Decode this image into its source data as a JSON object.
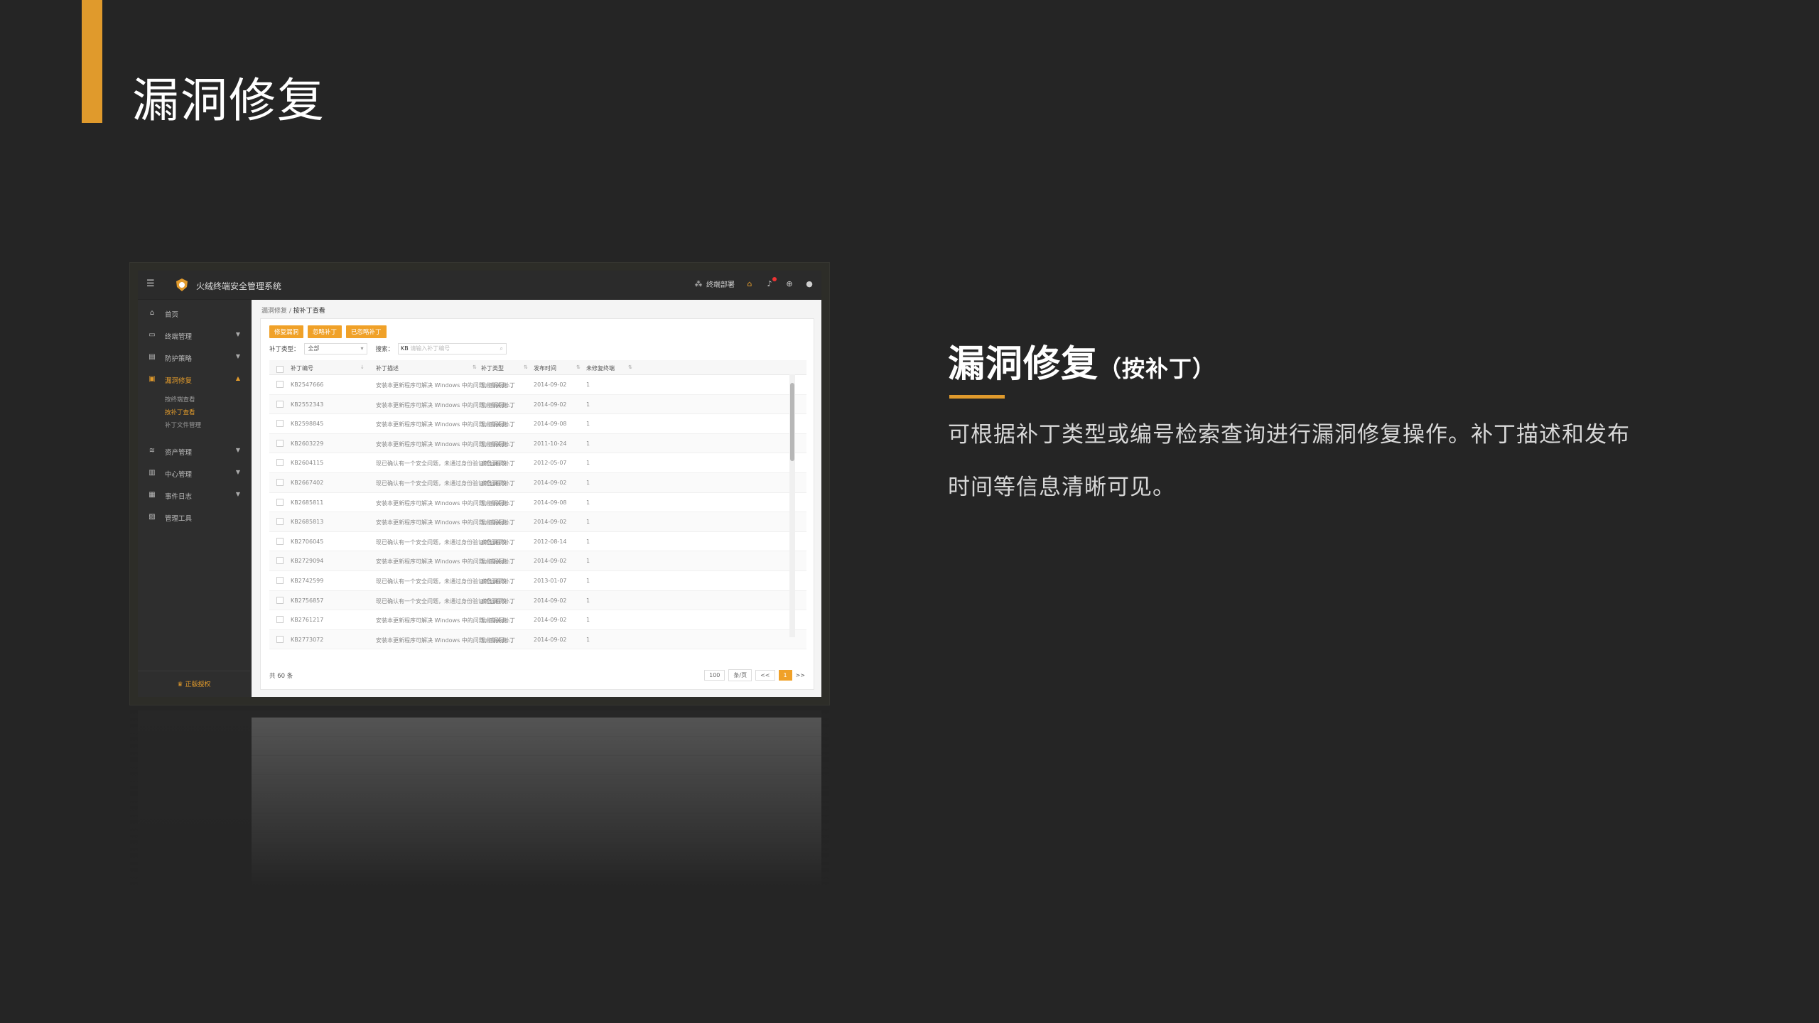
{
  "slide": {
    "title": "漏洞修复",
    "heading": "漏洞修复",
    "heading_sub": "（按补丁）",
    "description": "可根据补丁类型或编号检索查询进行漏洞修复操作。补丁描述和发布时间等信息清晰可见。",
    "accent_color": "#e09a2c"
  },
  "app": {
    "title": "火绒终端安全管理系统",
    "topbar": {
      "deploy_label": "终端部署",
      "icons": [
        "home-icon",
        "bell-icon",
        "globe-icon",
        "user-icon"
      ]
    },
    "sidebar": {
      "items": [
        {
          "label": "首页",
          "icon": "home-icon"
        },
        {
          "label": "终端管理",
          "icon": "monitor-icon"
        },
        {
          "label": "防护策略",
          "icon": "shield-icon"
        },
        {
          "label": "漏洞修复",
          "icon": "patch-icon",
          "active": true
        },
        {
          "label": "资产管理",
          "icon": "layers-icon"
        },
        {
          "label": "中心管理",
          "icon": "book-icon"
        },
        {
          "label": "事件日志",
          "icon": "log-icon"
        },
        {
          "label": "管理工具",
          "icon": "toolbox-icon"
        }
      ],
      "sub_items": [
        {
          "label": "按终端查看"
        },
        {
          "label": "按补丁查看",
          "active": true
        },
        {
          "label": "补丁文件管理"
        }
      ],
      "license": "正版授权"
    },
    "breadcrumb": {
      "parent": "漏洞修复",
      "current": "按补丁查看"
    },
    "buttons": [
      "修复漏洞",
      "忽略补丁",
      "已忽略补丁"
    ],
    "filter": {
      "type_label": "补丁类型：",
      "type_value": "全部",
      "search_label": "搜索：",
      "search_prefix": "KB",
      "search_placeholder": "请输入补丁编号"
    },
    "table": {
      "headers": [
        "补丁编号",
        "补丁描述",
        "补丁类型",
        "发布时间",
        "未修复终端"
      ],
      "rows": [
        {
          "id": "KB2547666",
          "desc": "安装本更新程序可解决 Windows 中的问题。有关此...",
          "type": "功能漏洞补丁",
          "date": "2014-09-02",
          "count": "1"
        },
        {
          "id": "KB2552343",
          "desc": "安装本更新程序可解决 Windows 中的问题。有关此...",
          "type": "功能漏洞补丁",
          "date": "2014-09-02",
          "count": "1"
        },
        {
          "id": "KB2598845",
          "desc": "安装本更新程序可解决 Windows 中的问题。有关此...",
          "type": "功能漏洞补丁",
          "date": "2014-09-08",
          "count": "1"
        },
        {
          "id": "KB2603229",
          "desc": "安装本更新程序可解决 Windows 中的问题。有关此...",
          "type": "功能漏洞补丁",
          "date": "2011-10-24",
          "count": "1"
        },
        {
          "id": "KB2604115",
          "desc": "现已确认有一个安全问题，未通过身份验证的远程攻...",
          "type": "高危漏洞补丁",
          "date": "2012-05-07",
          "count": "1"
        },
        {
          "id": "KB2667402",
          "desc": "现已确认有一个安全问题，未通过身份验证的远程攻...",
          "type": "高危漏洞补丁",
          "date": "2014-09-02",
          "count": "1"
        },
        {
          "id": "KB2685811",
          "desc": "安装本更新程序可解决 Windows 中的问题。有关此...",
          "type": "功能漏洞补丁",
          "date": "2014-09-08",
          "count": "1"
        },
        {
          "id": "KB2685813",
          "desc": "安装本更新程序可解决 Windows 中的问题。有关此...",
          "type": "功能漏洞补丁",
          "date": "2014-09-02",
          "count": "1"
        },
        {
          "id": "KB2706045",
          "desc": "现已确认有一个安全问题，未通过身份验证的远程攻...",
          "type": "高危漏洞补丁",
          "date": "2012-08-14",
          "count": "1"
        },
        {
          "id": "KB2729094",
          "desc": "安装本更新程序可解决 Windows 中的问题。有关此...",
          "type": "功能漏洞补丁",
          "date": "2014-09-02",
          "count": "1"
        },
        {
          "id": "KB2742599",
          "desc": "现已确认有一个安全问题，未通过身份验证的远程攻...",
          "type": "高危漏洞补丁",
          "date": "2013-01-07",
          "count": "1"
        },
        {
          "id": "KB2756857",
          "desc": "现已确认有一个安全问题，未通过身份验证的远程攻...",
          "type": "高危漏洞补丁",
          "date": "2014-09-02",
          "count": "1"
        },
        {
          "id": "KB2761217",
          "desc": "安装本更新程序可解决 Windows 中的问题。有关此...",
          "type": "功能漏洞补丁",
          "date": "2014-09-02",
          "count": "1"
        },
        {
          "id": "KB2773072",
          "desc": "安装本更新程序可解决 Windows 中的问题。有关此...",
          "type": "功能漏洞补丁",
          "date": "2014-09-02",
          "count": "1"
        }
      ]
    },
    "footer": {
      "total": "共 60 条",
      "page_size": "100",
      "per_page": "条/页",
      "prev": "<<",
      "page": "1",
      "next": ">>"
    }
  }
}
